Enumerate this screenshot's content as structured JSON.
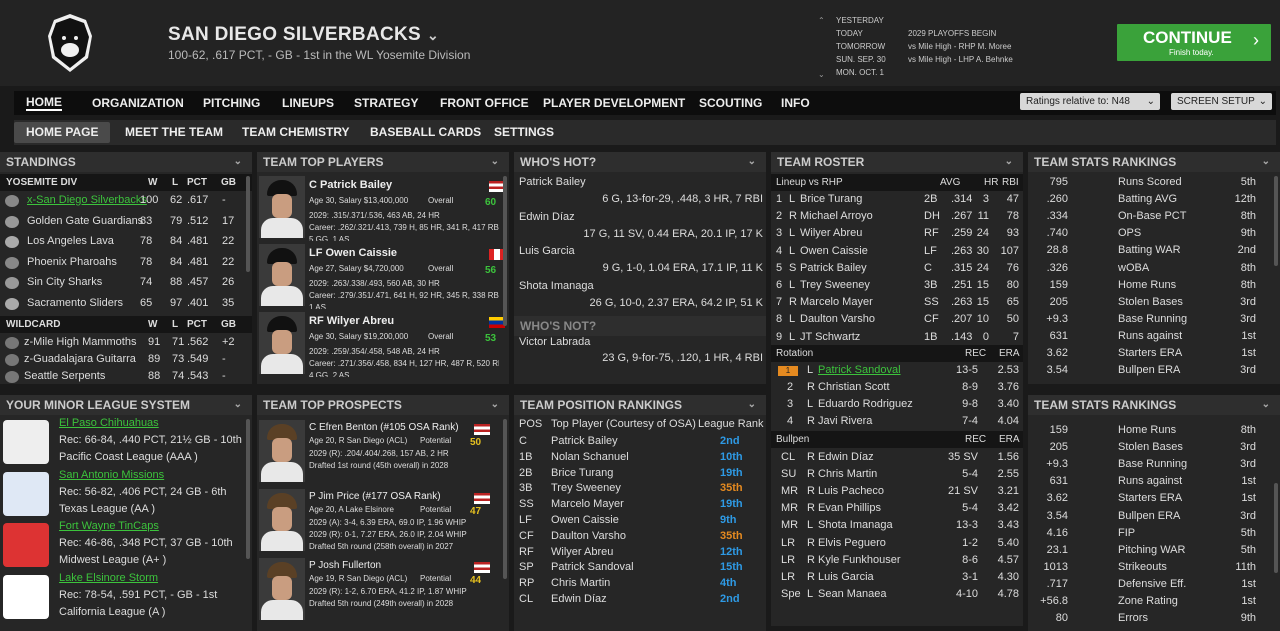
{
  "header": {
    "team_name": "SAN DIEGO SILVERBACKS",
    "record": "100-62, .617 PCT, - GB - 1st in the WL Yosemite Division",
    "schedule": [
      {
        "day": "YESTERDAY",
        "event": ""
      },
      {
        "day": "TODAY",
        "event": "2029 PLAYOFFS BEGIN"
      },
      {
        "day": "TOMORROW",
        "event": "vs Mile High - RHP M. Moree"
      },
      {
        "day": "SUN. SEP. 30",
        "event": "vs Mile High - LHP A. Behnke"
      },
      {
        "day": "MON. OCT. 1",
        "event": ""
      }
    ],
    "continue": "CONTINUE",
    "continue_sub": "Finish today."
  },
  "nav": {
    "items": [
      "HOME",
      "ORGANIZATION",
      "PITCHING",
      "LINEUPS",
      "STRATEGY",
      "FRONT OFFICE",
      "PLAYER DEVELOPMENT",
      "SCOUTING",
      "INFO"
    ],
    "ratings": "Ratings relative to: N48",
    "screen_setup": "SCREEN SETUP"
  },
  "subnav": [
    "HOME PAGE",
    "MEET THE TEAM",
    "TEAM CHEMISTRY",
    "BASEBALL CARDS",
    "SETTINGS"
  ],
  "standings": {
    "title": "STANDINGS",
    "div": "YOSEMITE DIV",
    "cols": [
      "W",
      "L",
      "PCT",
      "GB"
    ],
    "teams": [
      {
        "name": "x-San Diego Silverbacks",
        "w": "100",
        "l": "62",
        "pct": ".617",
        "gb": "-"
      },
      {
        "name": "Golden Gate Guardians",
        "w": "83",
        "l": "79",
        "pct": ".512",
        "gb": "17"
      },
      {
        "name": "Los Angeles Lava",
        "w": "78",
        "l": "84",
        "pct": ".481",
        "gb": "22"
      },
      {
        "name": "Phoenix Pharoahs",
        "w": "78",
        "l": "84",
        "pct": ".481",
        "gb": "22"
      },
      {
        "name": "Sin City Sharks",
        "w": "74",
        "l": "88",
        "pct": ".457",
        "gb": "26"
      },
      {
        "name": "Sacramento Sliders",
        "w": "65",
        "l": "97",
        "pct": ".401",
        "gb": "35"
      }
    ],
    "wc": "WILDCARD",
    "wcteams": [
      {
        "name": "z-Mile High Mammoths",
        "w": "91",
        "l": "71",
        "pct": ".562",
        "gb": "+2"
      },
      {
        "name": "z-Guadalajara Guitarra",
        "w": "89",
        "l": "73",
        "pct": ".549",
        "gb": "-"
      },
      {
        "name": "Seattle Serpents",
        "w": "88",
        "l": "74",
        "pct": ".543",
        "gb": "-"
      }
    ]
  },
  "top_players": {
    "title": "TEAM TOP PLAYERS",
    "players": [
      {
        "name": "C Patrick Bailey",
        "info": "Age 30, Salary $13,400,000",
        "ov": "Overall",
        "rating": "60",
        "s1": "2029: .315/.371/.536, 463 AB, 24 HR",
        "s2": "Career: .262/.321/.413, 739 H, 85 HR, 341 R, 417 RBI",
        "s3": "5 GG, 1 AS"
      },
      {
        "name": "LF Owen Caissie",
        "info": "Age 27, Salary $4,720,000",
        "ov": "Overall",
        "rating": "56",
        "s1": "2029: .263/.338/.493, 560 AB, 30 HR",
        "s2": "Career: .279/.351/.471, 641 H, 92 HR, 345 R, 338 RBI",
        "s3": "1 AS"
      },
      {
        "name": "RF Wilyer Abreu",
        "info": "Age 30, Salary $19,200,000",
        "ov": "Overall",
        "rating": "53",
        "s1": "2029: .259/.354/.458, 548 AB, 24 HR",
        "s2": "Career: .271/.356/.458, 834 H, 127 HR, 487 R, 520 RBI",
        "s3": "4 GG, 2 AS"
      }
    ]
  },
  "hot": {
    "title": "WHO'S HOT?",
    "players": [
      {
        "name": "Patrick Bailey",
        "line": "6 G, 13-for-29, .448, 3 HR, 7 RBI"
      },
      {
        "name": "Edwin Díaz",
        "line": "17 G, 11 SV, 0.44 ERA, 20.1 IP, 17 K"
      },
      {
        "name": "Luis Garcia",
        "line": "9 G, 1-0, 1.04 ERA, 17.1 IP, 11 K"
      },
      {
        "name": "Shota Imanaga",
        "line": "26 G, 10-0, 2.37 ERA, 64.2 IP, 51 K"
      }
    ],
    "not_title": "WHO'S NOT?",
    "not": [
      {
        "name": "Victor Labrada",
        "line": "23 G, 9-for-75, .120, 1 HR, 4 RBI"
      }
    ]
  },
  "roster": {
    "title": "TEAM ROSTER",
    "lineup": "Lineup vs RHP",
    "cols": [
      "AVG",
      "HR",
      "RBI"
    ],
    "batters": [
      {
        "n": "1",
        "h": "L",
        "name": "Brice Turang",
        "pos": "2B",
        "avg": ".314",
        "hr": "3",
        "rbi": "47"
      },
      {
        "n": "2",
        "h": "R",
        "name": "Michael Arroyo",
        "pos": "DH",
        "avg": ".267",
        "hr": "11",
        "rbi": "78"
      },
      {
        "n": "3",
        "h": "L",
        "name": "Wilyer Abreu",
        "pos": "RF",
        "avg": ".259",
        "hr": "24",
        "rbi": "93"
      },
      {
        "n": "4",
        "h": "L",
        "name": "Owen Caissie",
        "pos": "LF",
        "avg": ".263",
        "hr": "30",
        "rbi": "107"
      },
      {
        "n": "5",
        "h": "S",
        "name": "Patrick Bailey",
        "pos": "C",
        "avg": ".315",
        "hr": "24",
        "rbi": "76"
      },
      {
        "n": "6",
        "h": "L",
        "name": "Trey Sweeney",
        "pos": "3B",
        "avg": ".251",
        "hr": "15",
        "rbi": "80"
      },
      {
        "n": "7",
        "h": "R",
        "name": "Marcelo Mayer",
        "pos": "SS",
        "avg": ".263",
        "hr": "15",
        "rbi": "65"
      },
      {
        "n": "8",
        "h": "L",
        "name": "Daulton Varsho",
        "pos": "CF",
        "avg": ".207",
        "hr": "10",
        "rbi": "50"
      },
      {
        "n": "9",
        "h": "L",
        "name": "JT Schwartz",
        "pos": "1B",
        "avg": ".143",
        "hr": "0",
        "rbi": "7"
      }
    ],
    "rot_title": "Rotation",
    "rot_cols": [
      "REC",
      "ERA"
    ],
    "rotation": [
      {
        "n": "1",
        "h": "L",
        "name": "Patrick Sandoval",
        "rec": "13-5",
        "era": "2.53"
      },
      {
        "n": "2",
        "h": "R",
        "name": "Christian Scott",
        "rec": "8-9",
        "era": "3.76"
      },
      {
        "n": "3",
        "h": "L",
        "name": "Eduardo Rodriguez",
        "rec": "9-8",
        "era": "3.40"
      },
      {
        "n": "4",
        "h": "R",
        "name": "Javi Rivera",
        "rec": "7-4",
        "era": "4.04"
      }
    ],
    "bp_title": "Bullpen",
    "bp_cols": [
      "REC",
      "ERA"
    ],
    "bullpen": [
      {
        "r": "CL",
        "h": "R",
        "name": "Edwin Díaz",
        "rec": "35 SV",
        "era": "1.56"
      },
      {
        "r": "SU",
        "h": "R",
        "name": "Chris Martin",
        "rec": "5-4",
        "era": "2.55"
      },
      {
        "r": "MR",
        "h": "R",
        "name": "Luis Pacheco",
        "rec": "21 SV",
        "era": "3.21"
      },
      {
        "r": "MR",
        "h": "R",
        "name": "Evan Phillips",
        "rec": "5-4",
        "era": "3.42"
      },
      {
        "r": "MR",
        "h": "L",
        "name": "Shota Imanaga",
        "rec": "13-3",
        "era": "3.43"
      },
      {
        "r": "LR",
        "h": "R",
        "name": "Elvis Peguero",
        "rec": "1-2",
        "era": "5.40"
      },
      {
        "r": "LR",
        "h": "R",
        "name": "Kyle Funkhouser",
        "rec": "8-6",
        "era": "4.57"
      },
      {
        "r": "LR",
        "h": "R",
        "name": "Luis Garcia",
        "rec": "3-1",
        "era": "4.30"
      },
      {
        "r": "Spe",
        "h": "L",
        "name": "Sean Manaea",
        "rec": "4-10",
        "era": "4.78"
      }
    ]
  },
  "stats1": {
    "title": "TEAM STATS RANKINGS",
    "rows": [
      {
        "v": "795",
        "s": "Runs Scored",
        "r": "5th"
      },
      {
        "v": ".260",
        "s": "Batting AVG",
        "r": "12th"
      },
      {
        "v": ".334",
        "s": "On-Base PCT",
        "r": "8th"
      },
      {
        "v": ".740",
        "s": "OPS",
        "r": "9th"
      },
      {
        "v": "28.8",
        "s": "Batting WAR",
        "r": "2nd"
      },
      {
        "v": ".326",
        "s": "wOBA",
        "r": "8th"
      },
      {
        "v": "159",
        "s": "Home Runs",
        "r": "8th"
      },
      {
        "v": "205",
        "s": "Stolen Bases",
        "r": "3rd"
      },
      {
        "v": "+9.3",
        "s": "Base Running",
        "r": "3rd"
      },
      {
        "v": "631",
        "s": "Runs against",
        "r": "1st"
      },
      {
        "v": "3.62",
        "s": "Starters ERA",
        "r": "1st"
      },
      {
        "v": "3.54",
        "s": "Bullpen ERA",
        "r": "3rd"
      }
    ]
  },
  "stats2": {
    "title": "TEAM STATS RANKINGS",
    "rows": [
      {
        "v": "159",
        "s": "Home Runs",
        "r": "8th"
      },
      {
        "v": "205",
        "s": "Stolen Bases",
        "r": "3rd"
      },
      {
        "v": "+9.3",
        "s": "Base Running",
        "r": "3rd"
      },
      {
        "v": "631",
        "s": "Runs against",
        "r": "1st"
      },
      {
        "v": "3.62",
        "s": "Starters ERA",
        "r": "1st"
      },
      {
        "v": "3.54",
        "s": "Bullpen ERA",
        "r": "3rd"
      },
      {
        "v": "4.16",
        "s": "FIP",
        "r": "5th"
      },
      {
        "v": "23.1",
        "s": "Pitching WAR",
        "r": "5th"
      },
      {
        "v": "1013",
        "s": "Strikeouts",
        "r": "11th"
      },
      {
        "v": ".717",
        "s": "Defensive Eff.",
        "r": "1st"
      },
      {
        "v": "+56.8",
        "s": "Zone Rating",
        "r": "1st"
      },
      {
        "v": "80",
        "s": "Errors",
        "r": "9th"
      }
    ]
  },
  "minor": {
    "title": "YOUR MINOR LEAGUE SYSTEM",
    "teams": [
      {
        "name": "El Paso Chihuahuas",
        "rec": "Rec: 66-84, .440 PCT, 21½ GB - 10th",
        "lg": "Pacific Coast League (AAA )"
      },
      {
        "name": "San Antonio Missions",
        "rec": "Rec: 56-82, .406 PCT, 24 GB - 6th",
        "lg": "Texas League (AA )"
      },
      {
        "name": "Fort Wayne TinCaps",
        "rec": "Rec: 46-86, .348 PCT, 37 GB - 10th",
        "lg": "Midwest League (A+ )"
      },
      {
        "name": "Lake Elsinore Storm",
        "rec": "Rec: 78-54, .591 PCT, - GB - 1st",
        "lg": "California League (A )"
      }
    ]
  },
  "prospects": {
    "title": "TEAM TOP PROSPECTS",
    "players": [
      {
        "name": "C Efren Benton (#105 OSA Rank)",
        "info": "Age 20, R San Diego (ACL)",
        "pot": "Potential",
        "rating": "50",
        "s1": "2029 (R): .204/.404/.268, 157 AB, 2 HR",
        "s2": "Drafted 1st round (45th overall) in 2028"
      },
      {
        "name": "P Jim Price (#177 OSA Rank)",
        "info": "Age 20, A Lake Elsinore",
        "pot": "Potential",
        "rating": "47",
        "s1": "2029 (A): 3-4, 6.39 ERA, 69.0 IP, 1.96 WHIP",
        "s2": "2029 (R): 0-1, 7.27 ERA, 26.0 IP, 2.04 WHIP",
        "s3": "Drafted 5th round (258th overall) in 2027"
      },
      {
        "name": "P Josh Fullerton",
        "info": "Age 19, R San Diego (ACL)",
        "pot": "Potential",
        "rating": "44",
        "s1": "2029 (R): 1-2, 6.70 ERA, 41.2 IP, 1.87 WHIP",
        "s2": "Drafted 5th round (249th overall) in 2028"
      }
    ]
  },
  "positions": {
    "title": "TEAM POSITION RANKINGS",
    "cols": [
      "POS",
      "Top Player (Courtesy of OSA)",
      "League Rank"
    ],
    "rows": [
      {
        "p": "C",
        "n": "Patrick Bailey",
        "r": "2nd",
        "c": "b"
      },
      {
        "p": "1B",
        "n": "Nolan Schanuel",
        "r": "10th",
        "c": "b"
      },
      {
        "p": "2B",
        "n": "Brice Turang",
        "r": "19th",
        "c": "b"
      },
      {
        "p": "3B",
        "n": "Trey Sweeney",
        "r": "35th",
        "c": "o"
      },
      {
        "p": "SS",
        "n": "Marcelo Mayer",
        "r": "19th",
        "c": "b"
      },
      {
        "p": "LF",
        "n": "Owen Caissie",
        "r": "9th",
        "c": "b"
      },
      {
        "p": "CF",
        "n": "Daulton Varsho",
        "r": "35th",
        "c": "o"
      },
      {
        "p": "RF",
        "n": "Wilyer Abreu",
        "r": "12th",
        "c": "b"
      },
      {
        "p": "SP",
        "n": "Patrick Sandoval",
        "r": "15th",
        "c": "b"
      },
      {
        "p": "RP",
        "n": "Chris Martin",
        "r": "4th",
        "c": "b"
      },
      {
        "p": "CL",
        "n": "Edwin Díaz",
        "r": "2nd",
        "c": "b"
      }
    ]
  },
  "colors": {
    "accent_green": "#3aa23a",
    "rank_blue": "#2e9ae5",
    "rank_orange": "#e58a20",
    "rating_yellow": "#e5c020"
  }
}
